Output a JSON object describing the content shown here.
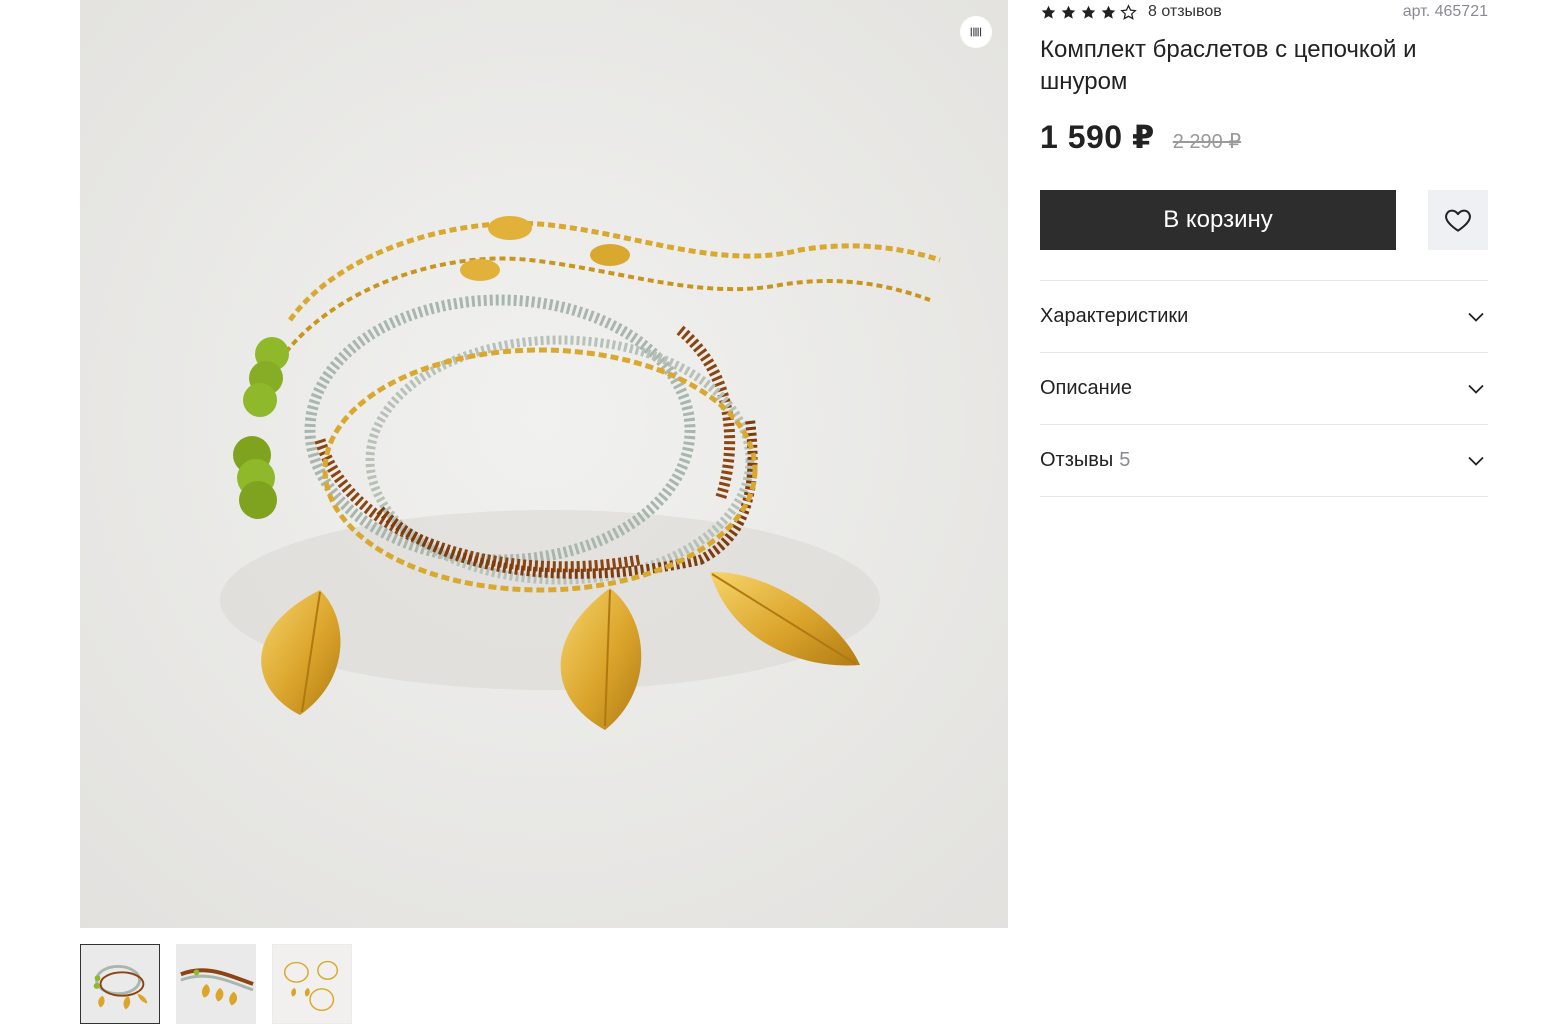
{
  "product": {
    "rating": 4,
    "rating_max": 5,
    "reviews_label": "8 отзывов",
    "sku_label": "арт. 465721",
    "title": "Комплект браслетов с цепочкой и шнуром",
    "price": "1 590 ₽",
    "old_price": "2 290 ₽"
  },
  "actions": {
    "cart_label": "В корзину",
    "favorite_icon": "heart-icon"
  },
  "accordion": [
    {
      "label": "Характеристики",
      "count": ""
    },
    {
      "label": "Описание",
      "count": ""
    },
    {
      "label": "Отзывы",
      "count": "5"
    }
  ],
  "gallery": {
    "thumbnail_count": 3,
    "active_index": 0,
    "overlay_icon": "barcode-icon"
  },
  "colors": {
    "accent_dark": "#2d2d2d",
    "muted_text": "#8a8a95",
    "photo_bg": "#ebeaea",
    "gold": "#d9a82e",
    "bead_green": "#8fb82a",
    "bead_brown": "#8a4512",
    "bead_grey": "#a9b6ad"
  }
}
